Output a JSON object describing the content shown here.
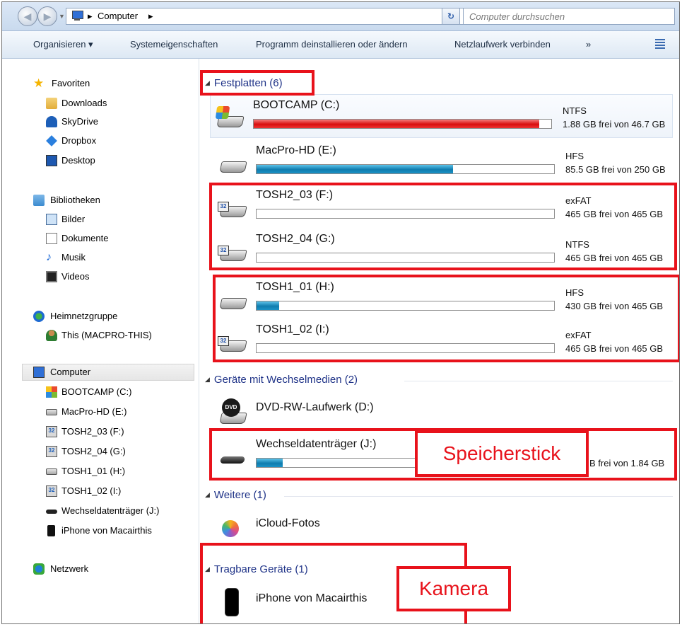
{
  "address": {
    "crumbs": [
      "Computer"
    ],
    "separator": "▸",
    "search_placeholder": "Computer durchsuchen"
  },
  "toolbar": {
    "organize": "Organisieren ▾",
    "system_properties": "Systemeigenschaften",
    "uninstall": "Programm deinstallieren oder ändern",
    "map_drive": "Netzlaufwerk verbinden",
    "more": "»"
  },
  "nav": {
    "favorites": "Favoriten",
    "downloads": "Downloads",
    "skydrive": "SkyDrive",
    "dropbox": "Dropbox",
    "desktop": "Desktop",
    "libraries": "Bibliotheken",
    "pictures": "Bilder",
    "documents": "Dokumente",
    "music": "Musik",
    "videos": "Videos",
    "homegroup": "Heimnetzgruppe",
    "homegroup_user": "This (MACPRO-THIS)",
    "computer": "Computer",
    "drives": [
      "BOOTCAMP (C:)",
      "MacPro-HD (E:)",
      "TOSH2_03 (F:)",
      "TOSH2_04 (G:)",
      "TOSH1_01 (H:)",
      "TOSH1_02 (I:)",
      "Wechseldatenträger (J:)",
      "iPhone von Macairthis"
    ],
    "network": "Netzwerk"
  },
  "groups": {
    "hdd": "Festplatten (6)",
    "removable": "Geräte mit Wechselmedien (2)",
    "other": "Weitere (1)",
    "portable": "Tragbare Geräte (1)"
  },
  "drives": [
    {
      "name": "BOOTCAMP (C:)",
      "fs": "NTFS",
      "free": "1.88 GB frei von 46.7 GB",
      "used_fraction": 0.96,
      "color": "red"
    },
    {
      "name": "MacPro-HD (E:)",
      "fs": "HFS",
      "free": "85.5 GB frei von 250 GB",
      "used_fraction": 0.66,
      "color": "blue"
    },
    {
      "name": "TOSH2_03 (F:)",
      "fs": "exFAT",
      "free": "465 GB frei von 465 GB",
      "used_fraction": 0.0,
      "color": "blue"
    },
    {
      "name": "TOSH2_04 (G:)",
      "fs": "NTFS",
      "free": "465 GB frei von 465 GB",
      "used_fraction": 0.0,
      "color": "blue"
    },
    {
      "name": "TOSH1_01 (H:)",
      "fs": "HFS",
      "free": "430 GB frei von 465 GB",
      "used_fraction": 0.075,
      "color": "blue"
    },
    {
      "name": "TOSH1_02 (I:)",
      "fs": "exFAT",
      "free": "465 GB frei von 465 GB",
      "used_fraction": 0.0,
      "color": "blue"
    }
  ],
  "removable": [
    {
      "name": "DVD-RW-Laufwerk (D:)"
    },
    {
      "name": "Wechseldatenträger (J:)",
      "free": "B frei von 1.84 GB",
      "used_fraction": 0.15
    }
  ],
  "other": [
    {
      "name": "iCloud-Fotos"
    }
  ],
  "portable": [
    {
      "name": "iPhone von Macairthis"
    }
  ],
  "annotations": {
    "usb_stick": "Speicherstick",
    "camera": "Kamera"
  },
  "colors": {
    "annotation": "#e8121b",
    "bar_blue": "#1a92c6",
    "bar_red": "#d80e0e",
    "group_title": "#1e3287"
  }
}
